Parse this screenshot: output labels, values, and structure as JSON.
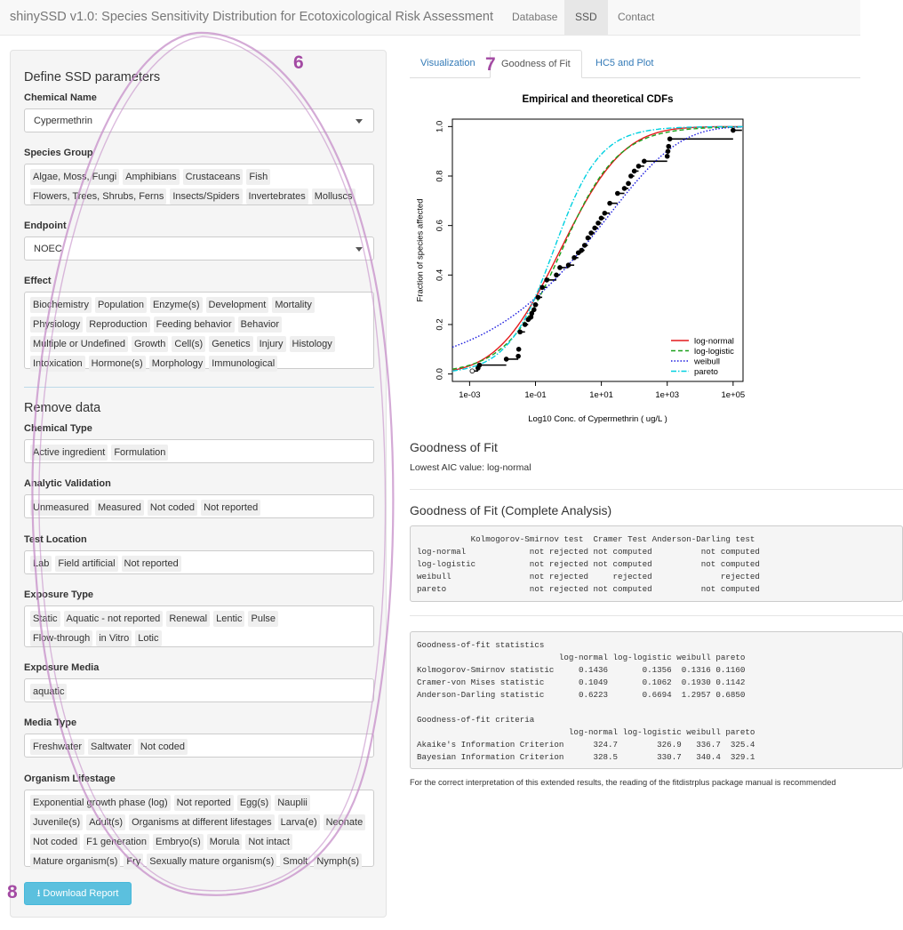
{
  "navbar": {
    "brand": "shinySSD v1.0: Species Sensitivity Distribution for Ecotoxicological Risk Assessment",
    "items": [
      "Database",
      "SSD",
      "Contact"
    ],
    "active": "SSD"
  },
  "sidebar": {
    "define_title": "Define SSD parameters",
    "chemical_name": {
      "label": "Chemical Name",
      "value": "Cypermethrin"
    },
    "species_group": {
      "label": "Species Group",
      "tags": [
        "Algae, Moss, Fungi",
        "Amphibians",
        "Crustaceans",
        "Fish",
        "Flowers, Trees, Shrubs, Ferns",
        "Insects/Spiders",
        "Invertebrates",
        "Molluscs"
      ]
    },
    "endpoint": {
      "label": "Endpoint",
      "value": "NOEC"
    },
    "effect": {
      "label": "Effect",
      "tags": [
        "Biochemistry",
        "Population",
        "Enzyme(s)",
        "Development",
        "Mortality",
        "Physiology",
        "Reproduction",
        "Feeding behavior",
        "Behavior",
        "Multiple or Undefined",
        "Growth",
        "Cell(s)",
        "Genetics",
        "Injury",
        "Histology",
        "Intoxication",
        "Hormone(s)",
        "Morphology",
        "Immunological"
      ]
    },
    "remove_title": "Remove data",
    "chemical_type": {
      "label": "Chemical Type",
      "tags": [
        "Active ingredient",
        "Formulation"
      ]
    },
    "analytic_validation": {
      "label": "Analytic Validation",
      "tags": [
        "Unmeasured",
        "Measured",
        "Not coded",
        "Not reported"
      ]
    },
    "test_location": {
      "label": "Test Location",
      "tags": [
        "Lab",
        "Field artificial",
        "Not reported"
      ]
    },
    "exposure_type": {
      "label": "Exposure Type",
      "tags": [
        "Static",
        "Aquatic - not reported",
        "Renewal",
        "Lentic",
        "Pulse",
        "Flow-through",
        "in Vitro",
        "Lotic"
      ]
    },
    "exposure_media": {
      "label": "Exposure Media",
      "tags": [
        "aquatic"
      ]
    },
    "media_type": {
      "label": "Media Type",
      "tags": [
        "Freshwater",
        "Saltwater",
        "Not coded"
      ]
    },
    "organism_lifestage": {
      "label": "Organism Lifestage",
      "tags": [
        "Exponential growth phase (log)",
        "Not reported",
        "Egg(s)",
        "Nauplii",
        "Juvenile(s)",
        "Adult(s)",
        "Organisms at different lifestages",
        "Larva(e)",
        "Neonate",
        "Not coded",
        "F1 generation",
        "Embryo(s)",
        "Morula",
        "Not intact",
        "Mature organism(s)",
        "Fry",
        "Sexually mature organism(s)",
        "Smolt",
        "Nymph(s)"
      ]
    },
    "download_button": "Download Report"
  },
  "tabs": [
    "Visualization",
    "Goodness of Fit",
    "HC5 and Plot"
  ],
  "active_tab": "Goodness of Fit",
  "annotations": [
    "6",
    "7",
    "8"
  ],
  "chart_data": {
    "type": "line",
    "title": "Empirical and theoretical CDFs",
    "xlabel": "Log10 Conc. of Cypermethrin ( ug/L )",
    "ylabel": "Fraction of species affected",
    "xscale": "log",
    "x_ticks": [
      "1e-03",
      "1e-01",
      "1e+01",
      "1e+03",
      "1e+05"
    ],
    "y_ticks": [
      "0.0",
      "0.2",
      "0.4",
      "0.6",
      "0.8",
      "1.0"
    ],
    "xlim": [
      0.0003,
      200000
    ],
    "ylim": [
      -0.03,
      1.03
    ],
    "legend_position": "bottom-right",
    "empirical": {
      "x": [
        0.0012,
        0.0018,
        0.002,
        0.013,
        0.03,
        0.031,
        0.034,
        0.048,
        0.06,
        0.073,
        0.077,
        0.09,
        0.1,
        0.12,
        0.16,
        0.22,
        0.43,
        0.55,
        1.0,
        1.5,
        2.0,
        2.5,
        3.1,
        3.9,
        4.9,
        6.3,
        8.0,
        9.9,
        12.6,
        18,
        31,
        50,
        66,
        79,
        100,
        135,
        200,
        1000,
        1050,
        1100,
        1200,
        100000
      ],
      "y": [
        0.012,
        0.024,
        0.036,
        0.06,
        0.072,
        0.1,
        0.17,
        0.2,
        0.22,
        0.23,
        0.245,
        0.26,
        0.28,
        0.31,
        0.35,
        0.38,
        0.4,
        0.43,
        0.44,
        0.47,
        0.49,
        0.5,
        0.52,
        0.55,
        0.57,
        0.59,
        0.61,
        0.63,
        0.65,
        0.69,
        0.73,
        0.75,
        0.77,
        0.8,
        0.82,
        0.84,
        0.86,
        0.88,
        0.9,
        0.92,
        0.95,
        0.985
      ]
    },
    "series": [
      {
        "name": "log-normal",
        "color": "#e41a1c",
        "style": "solid",
        "fn": "lnorm",
        "mu": -0.25,
        "sigma": 1.5
      },
      {
        "name": "log-logistic",
        "color": "#1ca01c",
        "style": "dash",
        "fn": "llogis",
        "mu": -0.2,
        "s": 0.85
      },
      {
        "name": "weibull",
        "color": "#1a1adf",
        "style": "dot",
        "fn": "weibull",
        "scale": 15,
        "shape": 0.2
      },
      {
        "name": "pareto",
        "color": "#00d0e0",
        "style": "dashdot",
        "fn": "llogis",
        "mu": -0.45,
        "s": 0.7
      }
    ]
  },
  "gof": {
    "title": "Goodness of Fit",
    "lowest_aic": "Lowest AIC value: log-normal",
    "complete_title": "Goodness of Fit (Complete Analysis)",
    "tests_table": "           Kolmogorov-Smirnov test  Cramer Test Anderson-Darling test\nlog-normal             not rejected not computed          not computed\nlog-logistic           not rejected not computed          not computed\nweibull                not rejected     rejected              rejected\npareto                 not rejected not computed          not computed",
    "stats_table": "Goodness-of-fit statistics\n                             log-normal log-logistic weibull pareto\nKolmogorov-Smirnov statistic     0.1436       0.1356  0.1316 0.1160\nCramer-von Mises statistic       0.1049       0.1062  0.1930 0.1142\nAnderson-Darling statistic       0.6223       0.6694  1.2957 0.6850\n\nGoodness-of-fit criteria\n                               log-normal log-logistic weibull pareto\nAkaike's Information Criterion      324.7        326.9   336.7  325.4\nBayesian Information Criterion      328.5        330.7   340.4  329.1",
    "footnote": "For the correct interpretation of this extended results, the reading of the fitdistrplus package manual is recommended"
  }
}
